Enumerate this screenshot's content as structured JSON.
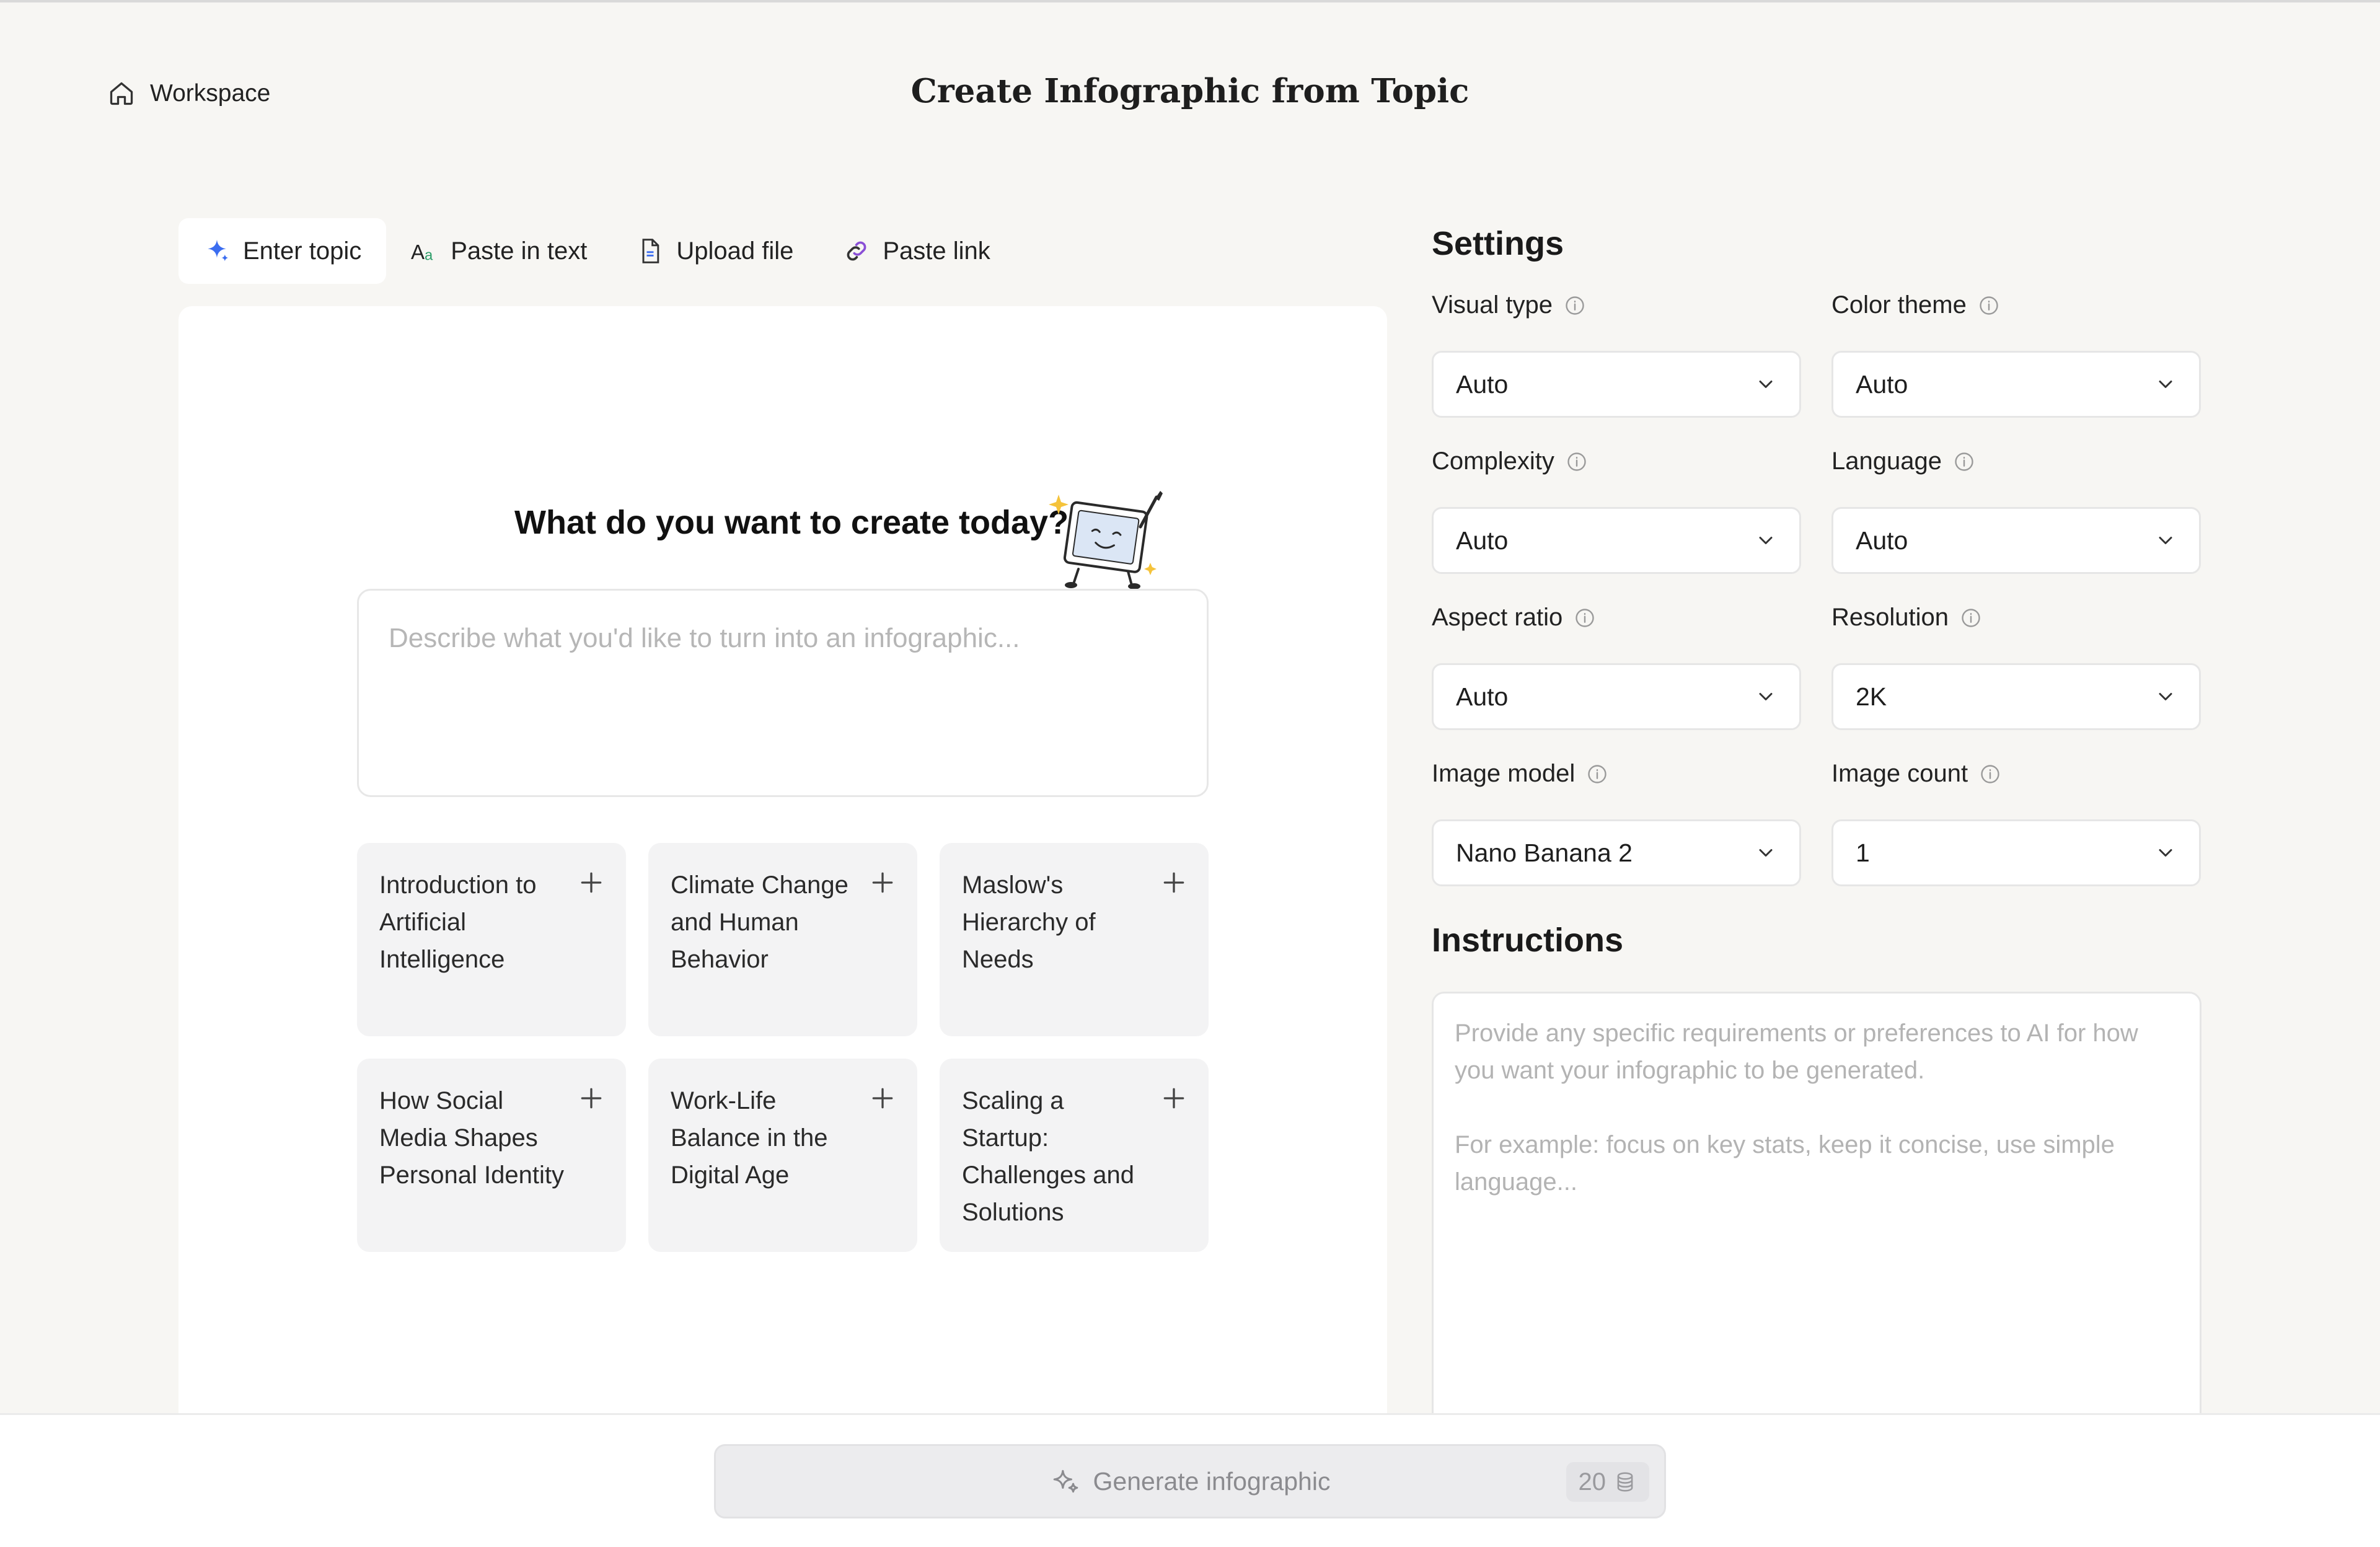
{
  "header": {
    "workspace_label": "Workspace",
    "title": "Create Infographic from Topic"
  },
  "tabs": [
    {
      "label": "Enter topic",
      "icon": "sparkle-icon",
      "active": true
    },
    {
      "label": "Paste in text",
      "icon": "text-aa-icon",
      "active": false
    },
    {
      "label": "Upload file",
      "icon": "file-icon",
      "active": false
    },
    {
      "label": "Paste link",
      "icon": "link-icon",
      "active": false
    }
  ],
  "main": {
    "prompt_title": "What do you want to create today?",
    "input_placeholder": "Describe what you'd like to turn into an infographic...",
    "suggestions": [
      "Introduction to Artificial Intelligence",
      "Climate Change and Human Behavior",
      "Maslow's Hierarchy of Needs",
      "How Social Media Shapes Personal Identity",
      "Work-Life Balance in the Digital Age",
      "Scaling a Startup: Challenges and Solutions"
    ]
  },
  "settings": {
    "title": "Settings",
    "fields": [
      {
        "label": "Visual type",
        "value": "Auto"
      },
      {
        "label": "Color theme",
        "value": "Auto"
      },
      {
        "label": "Complexity",
        "value": "Auto"
      },
      {
        "label": "Language",
        "value": "Auto"
      },
      {
        "label": "Aspect ratio",
        "value": "Auto"
      },
      {
        "label": "Resolution",
        "value": "2K"
      },
      {
        "label": "Image model",
        "value": "Nano Banana 2"
      },
      {
        "label": "Image count",
        "value": "1"
      }
    ],
    "instructions_title": "Instructions",
    "instructions_placeholder_1": "Provide any specific requirements or preferences to AI for how you want your infographic to be generated.",
    "instructions_placeholder_2": "For example: focus on key stats, keep it concise, use simple language..."
  },
  "footer": {
    "generate_label": "Generate infographic",
    "credits": "20"
  },
  "colors": {
    "background": "#f7f6f3",
    "accent_blue": "#3b6df0",
    "link_purple": "#8a4fd6"
  }
}
